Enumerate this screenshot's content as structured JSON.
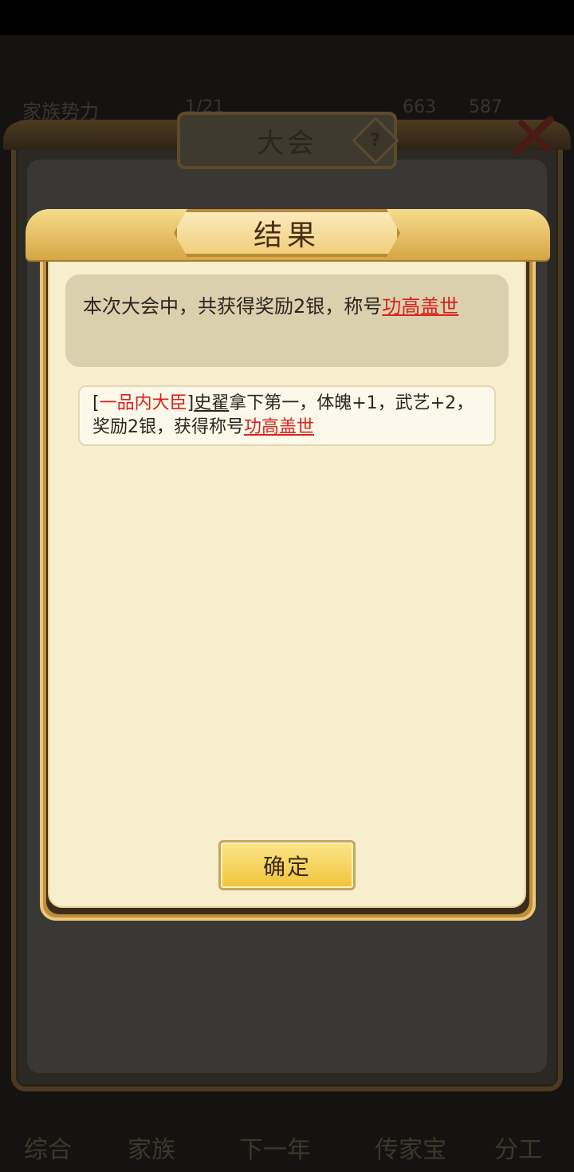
{
  "background": {
    "top_info": {
      "family_power_label": "家族势力",
      "fraction": "1/21",
      "stat_a": "663",
      "stat_b": "587"
    },
    "title": "大会",
    "help_glyph": "?",
    "bottom_nav": [
      "综合",
      "家族",
      "下一年",
      "传家宝",
      "分工"
    ]
  },
  "dialog": {
    "title": "结果",
    "summary_prefix": "本次大会中，共获得奖励2银，称号",
    "summary_title": "功高盖世",
    "log": {
      "bracket_open": "[",
      "rank": "一品内大臣",
      "bracket_close": "]",
      "name": "史翟",
      "text": "拿下第一，体魄+1，武艺+2，奖励2银，获得称号",
      "award_title": "功高盖世"
    },
    "confirm_label": "确定"
  },
  "colors": {
    "accent_red": "#d8221c",
    "paper": "#f6eecd",
    "gold": "#f1c43a"
  }
}
